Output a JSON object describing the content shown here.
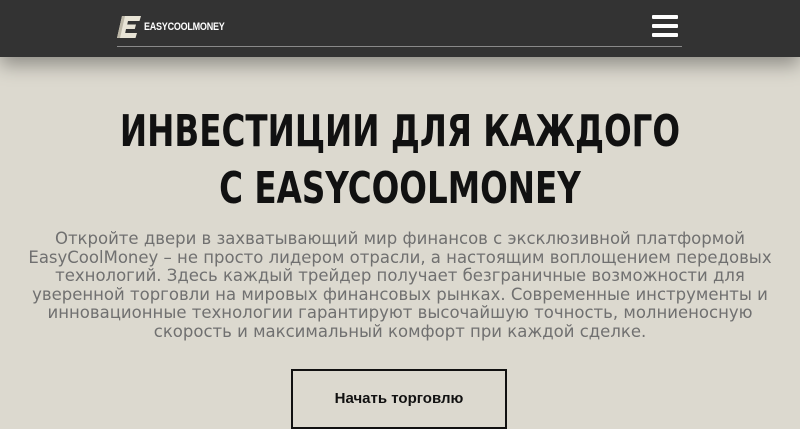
{
  "header": {
    "logo_text": "EASYCOOLMONEY",
    "logo_icon": "e-letter-logo-icon",
    "menu_icon": "hamburger-menu-icon"
  },
  "hero": {
    "title_line1": "ИНВЕСТИЦИИ ДЛЯ КАЖДОГО",
    "title_line2": "С EASYCOOLMONEY",
    "description_lines": [
      "Откройте двери в захватывающий мир финансов с эксклюзивной платформой",
      "EasyCoolMoney – не просто лидером отрасли, а настоящим воплощением передовых",
      "технологий. Здесь каждый трейдер получает безграничные возможности для",
      "уверенной торговли на мировых финансовых рынках. Современные инструменты и",
      "инновационные технологии гарантируют высочайшую точность, молниеносную",
      "скорость и максимальный комфорт при каждой сделке."
    ],
    "cta_label": "Начать торговлю"
  },
  "colors": {
    "header_bg": "#333333",
    "page_bg": "#dcd9cf",
    "title": "#111111",
    "body_text": "#707070"
  }
}
